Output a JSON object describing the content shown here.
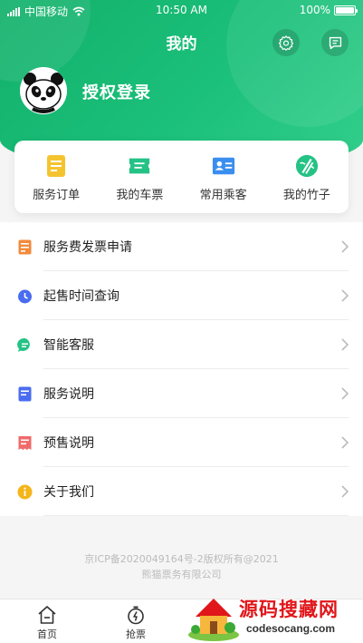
{
  "status_bar": {
    "carrier": "中国移动",
    "time": "10:50 AM",
    "battery": "100%",
    "battery_level": 1.0
  },
  "header": {
    "title": "我的",
    "settings_icon": "gear-icon",
    "message_icon": "message-icon"
  },
  "profile": {
    "login_label": "授权登录"
  },
  "quick_actions": [
    {
      "label": "服务订单",
      "icon": "order-icon",
      "color": "#f4c430"
    },
    {
      "label": "我的车票",
      "icon": "ticket-icon",
      "color": "#25c285"
    },
    {
      "label": "常用乘客",
      "icon": "passenger-icon",
      "color": "#3a8ef0"
    },
    {
      "label": "我的竹子",
      "icon": "bamboo-icon",
      "color": "#25c285"
    }
  ],
  "menu": [
    {
      "label": "服务费发票申请",
      "icon": "invoice-icon",
      "color": "#f28a3c"
    },
    {
      "label": "起售时间查询",
      "icon": "alarm-icon",
      "color": "#4a6cf0"
    },
    {
      "label": "智能客服",
      "icon": "chat-icon",
      "color": "#25c285"
    },
    {
      "label": "服务说明",
      "icon": "doc-icon",
      "color": "#4a6cf0"
    },
    {
      "label": "预售说明",
      "icon": "receipt-icon",
      "color": "#ef6a6a"
    },
    {
      "label": "关于我们",
      "icon": "info-icon",
      "color": "#f5b51a"
    }
  ],
  "footer": {
    "line1": "京ICP备2020049164号-2版权所有@2021",
    "line2": "熊猫票务有限公司"
  },
  "tabbar": [
    {
      "label": "首页",
      "icon": "home-icon"
    },
    {
      "label": "抢票",
      "icon": "stopwatch-icon"
    }
  ],
  "watermark": {
    "title": "源码搜藏网",
    "url": "codesocang.com"
  }
}
